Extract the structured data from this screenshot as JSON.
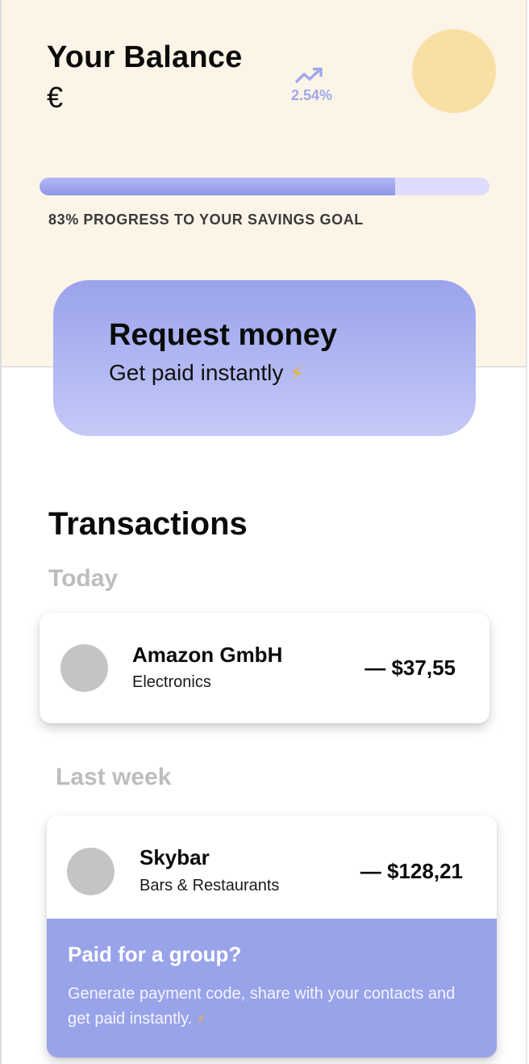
{
  "balance": {
    "title": "Your Balance",
    "currency_symbol": "€",
    "trend_icon": "trending-up-icon",
    "trend_value": "2.54%"
  },
  "savings": {
    "progress": 0.79,
    "label": "83% PROGRESS TO YOUR SAVINGS GOAL"
  },
  "request_card": {
    "title": "Request money",
    "subtitle": "Get paid instantly",
    "icon": "lightning-icon",
    "icon_glyph": "⚡"
  },
  "transactions": {
    "title": "Transactions",
    "groups": [
      {
        "label": "Today",
        "items": [
          {
            "name": "Amazon GmbH",
            "category": "Electronics",
            "amount": "— $37,55"
          }
        ]
      },
      {
        "label": "Last week",
        "items": [
          {
            "name": "Skybar",
            "category": "Bars & Restaurants",
            "amount": "— $128,21"
          }
        ]
      }
    ]
  },
  "group_payment": {
    "title": "Paid for a group?",
    "description": "Generate payment code, share with your contacts and get paid instantly.",
    "icon_glyph": "⚡"
  },
  "colors": {
    "header_bg": "#fdf4e8",
    "accent": "#99a3ea",
    "avatar_yellow": "#f8e0a5",
    "placeholder_gray": "#c4c4c4"
  }
}
